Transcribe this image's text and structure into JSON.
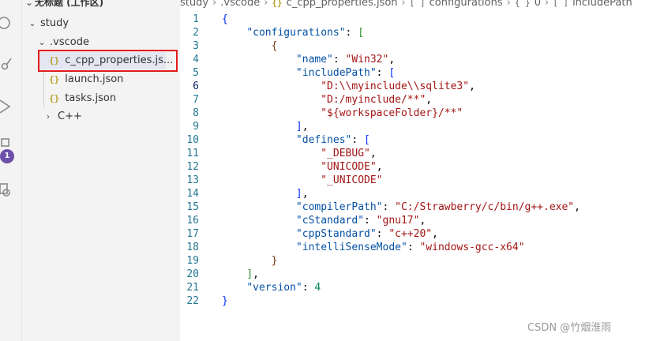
{
  "activity_bar": {
    "icons": [
      "search-icon",
      "source-control-icon",
      "run-debug-icon",
      "extensions-icon",
      "remote-settings-icon"
    ],
    "extensions_badge": "1"
  },
  "explorer": {
    "workspace_title": "无标题 (工作区)",
    "folder": "study",
    "subfolder": ".vscode",
    "files": [
      "c_cpp_properties.js...",
      "launch.json",
      "tasks.json"
    ],
    "cpp_folder": "C++"
  },
  "breadcrumb": {
    "items": [
      "study",
      ".vscode",
      "c_cpp_properties.json",
      "configurations",
      "0",
      "includePath"
    ]
  },
  "editor": {
    "active_line": 6,
    "line_numbers": [
      "1",
      "2",
      "3",
      "4",
      "5",
      "6",
      "7",
      "8",
      "9",
      "10",
      "11",
      "12",
      "13",
      "14",
      "15",
      "16",
      "17",
      "18",
      "19",
      "20",
      "21",
      "22"
    ],
    "keys": {
      "configurations": "\"configurations\"",
      "name": "\"name\"",
      "includePath": "\"includePath\"",
      "defines": "\"defines\"",
      "compilerPath": "\"compilerPath\"",
      "cStandard": "\"cStandard\"",
      "cppStandard": "\"cppStandard\"",
      "intelliSenseMode": "\"intelliSenseMode\"",
      "version": "\"version\""
    },
    "values": {
      "name": "\"Win32\"",
      "includePath": [
        "\"D:\\\\myinclude\\\\sqlite3\"",
        "\"D:/myinclude/**\"",
        "\"${workspaceFolder}/**\""
      ],
      "defines": [
        "\"_DEBUG\"",
        "\"UNICODE\"",
        "\"_UNICODE\""
      ],
      "compilerPath": "\"C:/Strawberry/c/bin/g++.exe\"",
      "cStandard": "\"gnu17\"",
      "cppStandard": "\"c++20\"",
      "intelliSenseMode": "\"windows-gcc-x64\"",
      "version": "4"
    }
  },
  "watermark": "CSDN @竹烟淮雨"
}
